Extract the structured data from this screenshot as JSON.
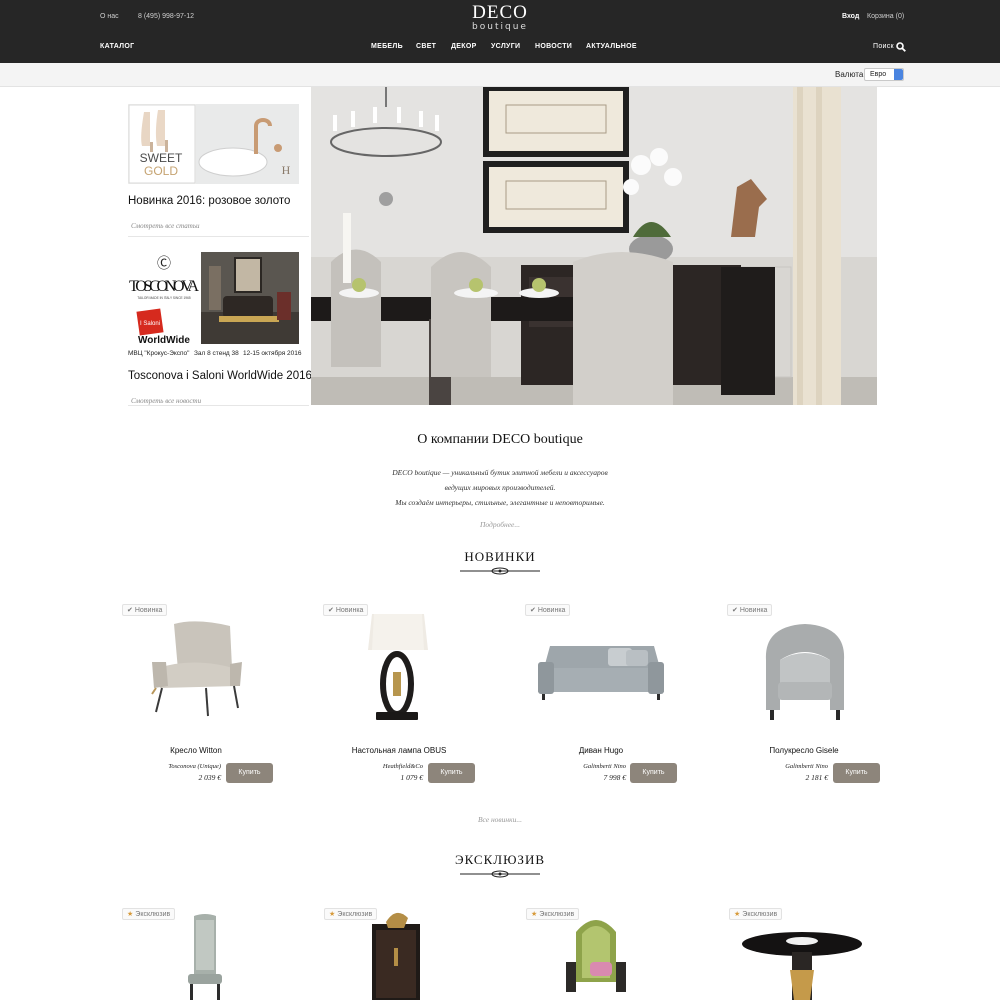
{
  "header": {
    "about_link": "О нас",
    "phone": "8 (495) 998-97-12",
    "logo_line1": "DECO",
    "logo_line2": "boutique",
    "login": "Вход",
    "cart": "Корзина (0)",
    "catalog": "КАТАЛОГ",
    "nav": [
      "МЕБЕЛЬ",
      "СВЕТ",
      "ДЕКОР",
      "УСЛУГИ",
      "НОВОСТИ",
      "АКТУАЛЬНОЕ"
    ],
    "search": "Поиск"
  },
  "currency": {
    "label": "Валюта",
    "selected": "Евро"
  },
  "news": [
    {
      "image_text": "SWEET GOLD",
      "title": "Новинка 2016: розовое золото",
      "more": "Смотреть все статьи"
    },
    {
      "brand_logo": "TOSCONOVA",
      "brand_tagline": "TAILOR MADE IN ITALY SINCE 1965",
      "event_logo": "WorldWide",
      "event_logo_badge": "I Saloni",
      "venue": "МВЦ \"Крокус-Экспо\"",
      "hall": "Зал 8  стенд 38",
      "dates": "12-15 октября 2016",
      "title": "Tosconova i Saloni WorldWide 2016",
      "more": "Смотреть все новости"
    }
  ],
  "about": {
    "title": "О компании DECO boutique",
    "lines": [
      "DECO boutique — уникальный бутик элитной мебели и аксессуаров",
      "ведущих мировых производителей.",
      "Мы создаём интерьеры, стильные, элегантные и неповторимые."
    ],
    "more": "Подробнее..."
  },
  "new_section": {
    "title": "НОВИНКИ",
    "badge": "Новинка",
    "buy_label": "Купить",
    "all_link": "Все новинки...",
    "products": [
      {
        "name": "Кресло Witton",
        "brand": "Tosconova (Unique)",
        "price": "2 039 €"
      },
      {
        "name": "Настольная лампа OBUS",
        "brand": "Heathfield&Co",
        "price": "1 079 €"
      },
      {
        "name": "Диван Hugo",
        "brand": "Galimberti Nino",
        "price": "7 998 €"
      },
      {
        "name": "Полукресло Gisele",
        "brand": "Galimberti Nino",
        "price": "2 181 €"
      }
    ]
  },
  "exclusive_section": {
    "title": "ЭКСКЛЮЗИВ",
    "badge": "Эксклюзив"
  }
}
